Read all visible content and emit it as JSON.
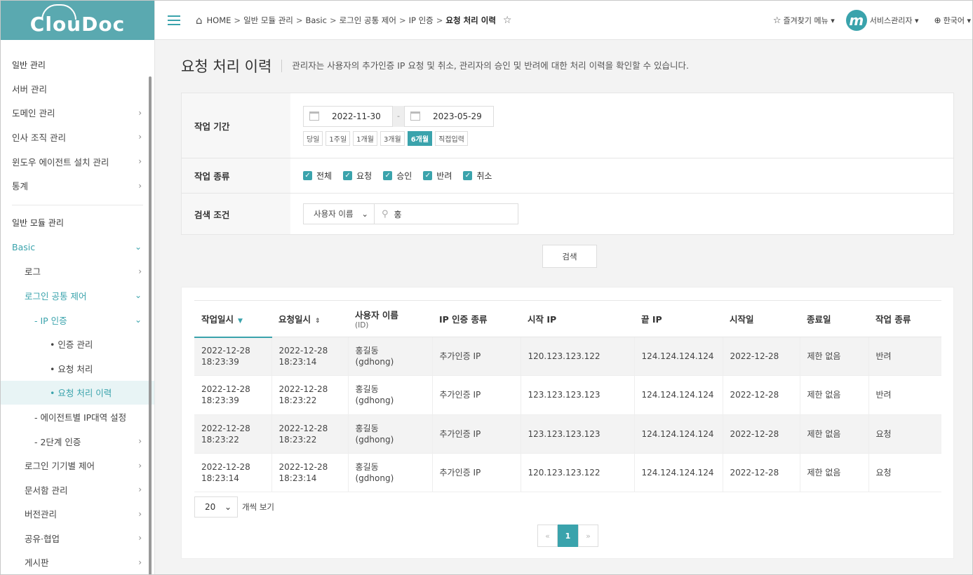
{
  "app": {
    "logo": "ClouDoc"
  },
  "sidebar": {
    "section1": "일반 관리",
    "items1": [
      {
        "label": "서버 관리",
        "chev": ""
      },
      {
        "label": "도메인 관리",
        "chev": "›"
      },
      {
        "label": "인사 조직 관리",
        "chev": "›"
      },
      {
        "label": "윈도우 에이전트 설치 관리",
        "chev": "›"
      },
      {
        "label": "통계",
        "chev": "›"
      }
    ],
    "section2": "일반 모듈 관리",
    "basic": "Basic",
    "log": "로그",
    "login_control": "로그인 공통 제어",
    "ip_auth": "- IP 인증",
    "auth_manage": "• 인증 관리",
    "request_process": "• 요청 처리",
    "request_history": "• 요청 처리 이력",
    "agent_ip": "- 에이전트별 IP대역 설정",
    "two_factor": "- 2단계 인증",
    "items2": [
      {
        "label": "로그인 기기별 제어",
        "chev": "›"
      },
      {
        "label": "문서함 관리",
        "chev": "›"
      },
      {
        "label": "버전관리",
        "chev": "›"
      },
      {
        "label": "공유·협업",
        "chev": "›"
      },
      {
        "label": "게시판",
        "chev": "›"
      }
    ],
    "chev_right": "›",
    "chev_down": "⌄"
  },
  "topbar": {
    "breadcrumb": [
      "HOME",
      "일반 모듈 관리",
      "Basic",
      "로그인 공통 제어",
      "IP 인증"
    ],
    "sep": ">",
    "current": "요청 처리 이력",
    "fav_menu": "즐겨찾기 메뉴 ▾",
    "avatar_letter": "m",
    "user": "서비스관리자 ▾",
    "lang": "한국어 ▾"
  },
  "page": {
    "title": "요청 처리 이력",
    "desc": "관리자는 사용자의 추가인증 IP 요청 및 취소, 관리자의 승인 및 반려에 대한 처리 이력을 확인할 수 있습니다."
  },
  "filter": {
    "period_label": "작업 기간",
    "date_from": "2022-11-30",
    "date_sep": "-",
    "date_to": "2023-05-29",
    "quick": [
      "당일",
      "1주일",
      "1개월",
      "3개월",
      "6개월",
      "직접입력"
    ],
    "type_label": "작업 종류",
    "types": [
      "전체",
      "요청",
      "승인",
      "반려",
      "취소"
    ],
    "check": "✓",
    "cond_label": "검색 조건",
    "cond_select": "사용자 이름",
    "cond_value": "홍"
  },
  "search_button": "검색",
  "table": {
    "headers": [
      {
        "label": "작업일시",
        "sub": ""
      },
      {
        "label": "요청일시",
        "sub": ""
      },
      {
        "label": "사용자 이름",
        "sub": "(ID)"
      },
      {
        "label": "IP 인증 종류",
        "sub": ""
      },
      {
        "label": "시작 IP",
        "sub": ""
      },
      {
        "label": "끝 IP",
        "sub": ""
      },
      {
        "label": "시작일",
        "sub": ""
      },
      {
        "label": "종료일",
        "sub": ""
      },
      {
        "label": "작업 종류",
        "sub": ""
      }
    ],
    "rows": [
      {
        "work_date": "2022-12-28",
        "work_time": "18:23:39",
        "req_date": "2022-12-28",
        "req_time": "18:23:14",
        "name": "홍길동",
        "id": "(gdhong)",
        "auth_type": "추가인증 IP",
        "start_ip": "120.123.123.122",
        "end_ip": "124.124.124.124",
        "start_day": "2022-12-28",
        "end_day": "제한 없음",
        "work_type": "반려"
      },
      {
        "work_date": "2022-12-28",
        "work_time": "18:23:39",
        "req_date": "2022-12-28",
        "req_time": "18:23:22",
        "name": "홍길동",
        "id": "(gdhong)",
        "auth_type": "추가인증 IP",
        "start_ip": "123.123.123.123",
        "end_ip": "124.124.124.124",
        "start_day": "2022-12-28",
        "end_day": "제한 없음",
        "work_type": "반려"
      },
      {
        "work_date": "2022-12-28",
        "work_time": "18:23:22",
        "req_date": "2022-12-28",
        "req_time": "18:23:22",
        "name": "홍길동",
        "id": "(gdhong)",
        "auth_type": "추가인증 IP",
        "start_ip": "123.123.123.123",
        "end_ip": "124.124.124.124",
        "start_day": "2022-12-28",
        "end_day": "제한 없음",
        "work_type": "요청"
      },
      {
        "work_date": "2022-12-28",
        "work_time": "18:23:14",
        "req_date": "2022-12-28",
        "req_time": "18:23:14",
        "name": "홍길동",
        "id": "(gdhong)",
        "auth_type": "추가인증 IP",
        "start_ip": "120.123.123.122",
        "end_ip": "124.124.124.124",
        "start_day": "2022-12-28",
        "end_day": "제한 없음",
        "work_type": "요청"
      }
    ]
  },
  "pagination": {
    "rows_per_page": "20",
    "rows_label": "개씩 보기",
    "prev": "«",
    "current": "1",
    "next": "»"
  },
  "colors": {
    "accent": "#3aa3ac",
    "logo_bg": "#5aa9b0"
  }
}
